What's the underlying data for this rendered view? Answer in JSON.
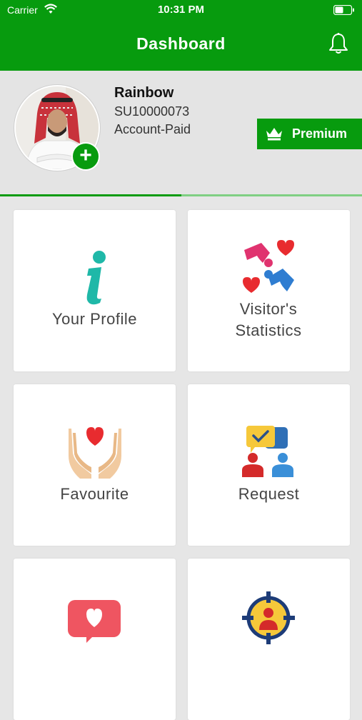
{
  "status_bar": {
    "carrier": "Carrier",
    "time": "10:31 PM"
  },
  "header": {
    "title": "Dashboard"
  },
  "profile": {
    "name": "Rainbow",
    "id": "SU10000073",
    "account": "Account-Paid",
    "add_symbol": "+",
    "premium_label": "Premium"
  },
  "progress": {
    "fraction": 0.5
  },
  "cards": [
    {
      "label": "Your Profile",
      "icon": "info-icon"
    },
    {
      "label": "Visitor's Statistics",
      "icon": "visitor-statistics-icon"
    },
    {
      "label": "Favourite",
      "icon": "hands-heart-icon"
    },
    {
      "label": "Request",
      "icon": "request-icon"
    },
    {
      "label": "",
      "icon": "heart-chat-icon"
    },
    {
      "label": "",
      "icon": "target-person-icon"
    }
  ],
  "colors": {
    "brand": "#079b0e",
    "background": "#e6e6e6",
    "card": "#ffffff",
    "label": "#444444"
  }
}
